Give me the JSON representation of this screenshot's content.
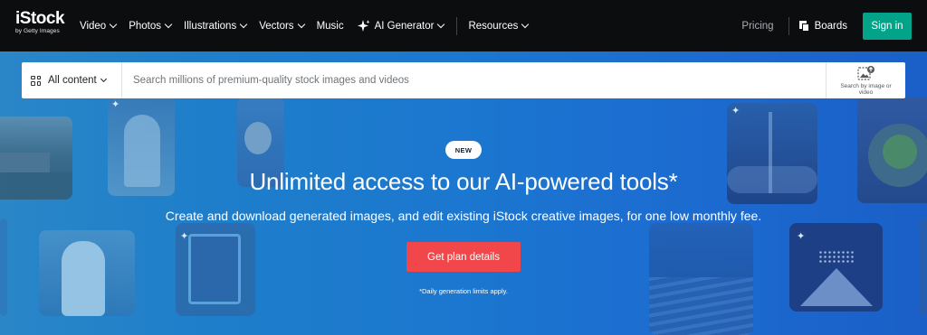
{
  "brand": {
    "name": "iStock",
    "tagline": "by Getty Images"
  },
  "nav": {
    "items": [
      {
        "label": "Video"
      },
      {
        "label": "Photos"
      },
      {
        "label": "Illustrations"
      },
      {
        "label": "Vectors"
      },
      {
        "label": "Music"
      },
      {
        "label": "AI Generator"
      },
      {
        "label": "Resources"
      }
    ],
    "pricing": "Pricing",
    "boards": "Boards",
    "sign_in": "Sign in"
  },
  "search": {
    "scope": "All content",
    "placeholder": "Search millions of premium-quality stock images and videos",
    "image_search_label": "Search by image or video"
  },
  "hero": {
    "badge": "NEW",
    "headline": "Unlimited access to our AI-powered tools*",
    "subline": "Create and download generated images, and edit existing iStock creative images, for one low monthly fee.",
    "cta": "Get plan details",
    "note": "*Daily generation limits apply."
  },
  "colors": {
    "topbar": "#0c0d0f",
    "sign_in": "#02a388",
    "cta": "#f2474a",
    "hero_blue": "#1b77cf"
  }
}
